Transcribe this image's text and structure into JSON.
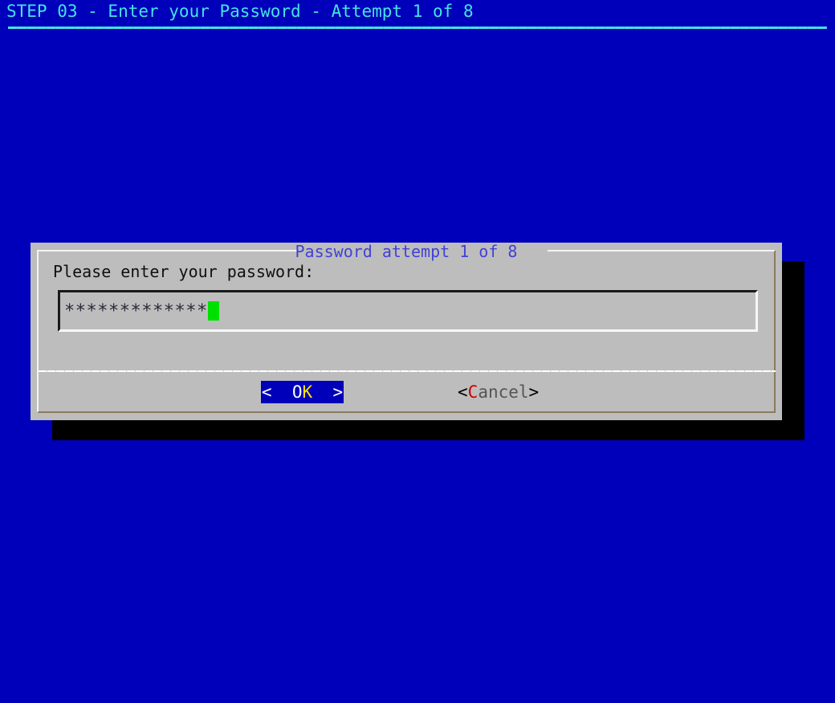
{
  "screen": {
    "background_color": "#0000bb",
    "step_header": {
      "title": "STEP 03 - Enter your Password - Attempt 1 of 8",
      "text_color": "#44e4e4",
      "rule_color": "#44e4e4"
    }
  },
  "dialog": {
    "title": "Password attempt 1 of 8",
    "title_color": "#4141d8",
    "background_color": "#bdbdbd",
    "prompt": "Please enter your password:",
    "prompt_color": "#101010",
    "input": {
      "name": "password-input",
      "masked_value": "**************",
      "mask_character": "*",
      "character_count": 14,
      "cursor_color": "#00e000",
      "cursor_visible": true,
      "placeholder": ""
    },
    "buttons": [
      {
        "id": "ok",
        "open_bracket": "<",
        "hotkey": "O",
        "rest": "K",
        "close_bracket": ">",
        "full_label": "<  OK  >",
        "selected": true,
        "highlight_background": "#0000bb",
        "bracket_color": "#ffffff",
        "hotkey_color": "#ffffff",
        "rest_color": "#ffe000"
      },
      {
        "id": "cancel",
        "open_bracket": "<",
        "hotkey": "C",
        "rest": "ancel",
        "close_bracket": ">",
        "full_label": "<Cancel>",
        "selected": false,
        "highlight_background": "transparent",
        "bracket_color": "#000000",
        "hotkey_color": "#cc0000",
        "rest_color": "#555555"
      }
    ]
  }
}
